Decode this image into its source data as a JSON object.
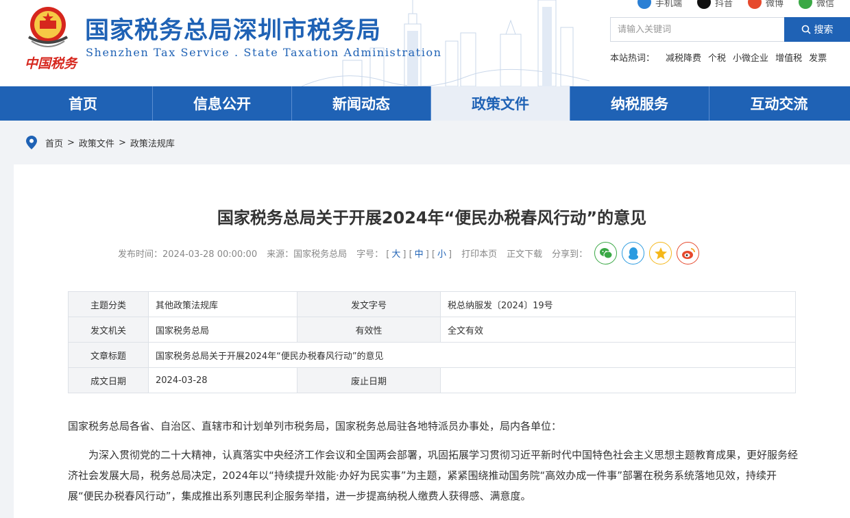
{
  "header": {
    "site_title": "国家税务总局深圳市税务局",
    "site_subtitle": "Shenzhen Tax Service . State Taxation Administration",
    "logo_text": "中国税务",
    "social": [
      {
        "label": "手机端",
        "icon": "mobile-icon",
        "color": "#2a7fd4"
      },
      {
        "label": "抖音",
        "icon": "douyin-icon",
        "color": "#111111"
      },
      {
        "label": "微博",
        "icon": "weibo-icon",
        "color": "#e6492d"
      },
      {
        "label": "微信",
        "icon": "wechat-icon",
        "color": "#3aa845"
      }
    ],
    "search": {
      "placeholder": "请输入关键词",
      "button": "搜索"
    },
    "hot": {
      "label": "本站热词：",
      "items": [
        "减税降费",
        "个税",
        "小微企业",
        "增值税",
        "发票"
      ]
    }
  },
  "nav": {
    "items": [
      "首页",
      "信息公开",
      "新闻动态",
      "政策文件",
      "纳税服务",
      "互动交流"
    ],
    "active": "政策文件"
  },
  "breadcrumb": [
    "首页",
    "政策文件",
    "政策法规库"
  ],
  "article": {
    "title": "国家税务总局关于开展2024年“便民办税春风行动”的意见",
    "meta": {
      "published_label": "发布时间：",
      "published": "2024-03-28 00:00:00",
      "source_label": "来源：",
      "source": "国家税务总局",
      "size_label": "字号：",
      "size_large": "大",
      "size_medium": "中",
      "size_small": "小",
      "print": "打印本页",
      "download": "正文下载",
      "share_label": "分享到："
    },
    "info": {
      "topic_label": "主题分类",
      "topic": "其他政策法规库",
      "doc_no_label": "发文字号",
      "doc_no": "税总纳服发〔2024〕19号",
      "issuer_label": "发文机关",
      "issuer": "国家税务总局",
      "validity_label": "有效性",
      "validity": "全文有效",
      "title_label": "文章标题",
      "title": "国家税务总局关于开展2024年“便民办税春风行动”的意见",
      "date_label": "成文日期",
      "date": "2024-03-28",
      "abolish_label": "废止日期",
      "abolish": ""
    },
    "greeting": "国家税务总局各省、自治区、直辖市和计划单列市税务局，国家税务总局驻各地特派员办事处，局内各单位：",
    "paragraph": "为深入贯彻党的二十大精神，认真落实中央经济工作会议和全国两会部署，巩固拓展学习贯彻习近平新时代中国特色社会主义思想主题教育成果，更好服务经济社会发展大局，税务总局决定，2024年以“持续提升效能·办好为民实事”为主题，紧紧围绕推动国务院“高效办成一件事”部署在税务系统落地见效，持续开展“便民办税春风行动”，集成推出系列惠民利企服务举措，进一步提高纳税人缴费人获得感、满意度。"
  },
  "colors": {
    "brand": "#1f62b5",
    "red": "#d6261d"
  }
}
